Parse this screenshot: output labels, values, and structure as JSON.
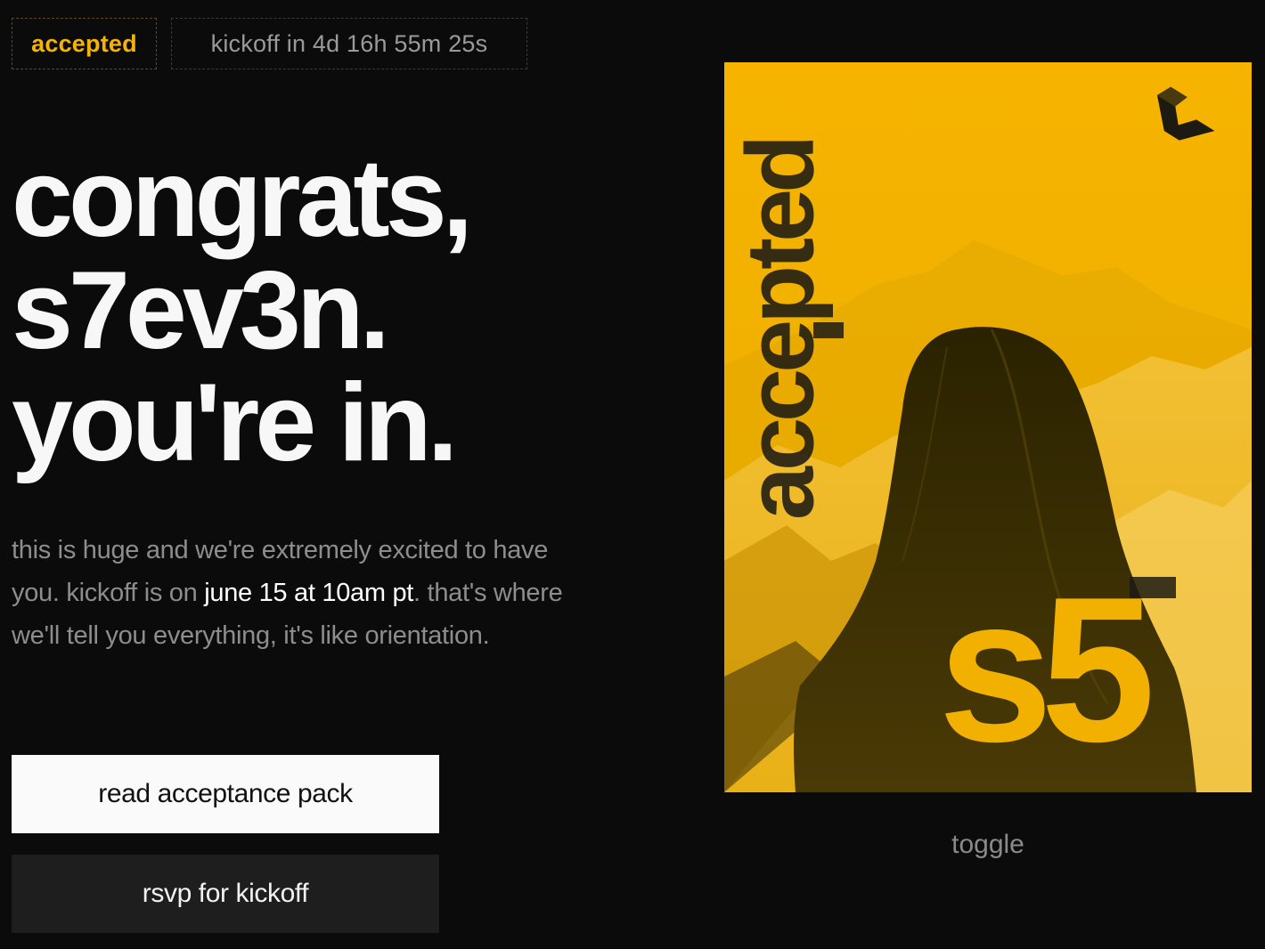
{
  "status": {
    "accepted_label": "accepted",
    "countdown": "kickoff in 4d 16h 55m 25s"
  },
  "headline": {
    "line1": "congrats,",
    "line2": "s7ev3n.",
    "line3": "you're in."
  },
  "body": {
    "part1": "this is huge and we're extremely excited to have you. kickoff is on ",
    "highlight": "june 15 at 10am pt",
    "part2": ". that's where we'll tell you everything, it's like orientation."
  },
  "actions": {
    "primary_label": "read acceptance pack",
    "secondary_label": "rsvp for kickoff"
  },
  "poster": {
    "vertical_text": "accepted",
    "season_text": "s5",
    "accent_color": "#f2b000",
    "logo_icon": "folded-ribbon-logo-icon"
  },
  "toggle_label": "toggle"
}
